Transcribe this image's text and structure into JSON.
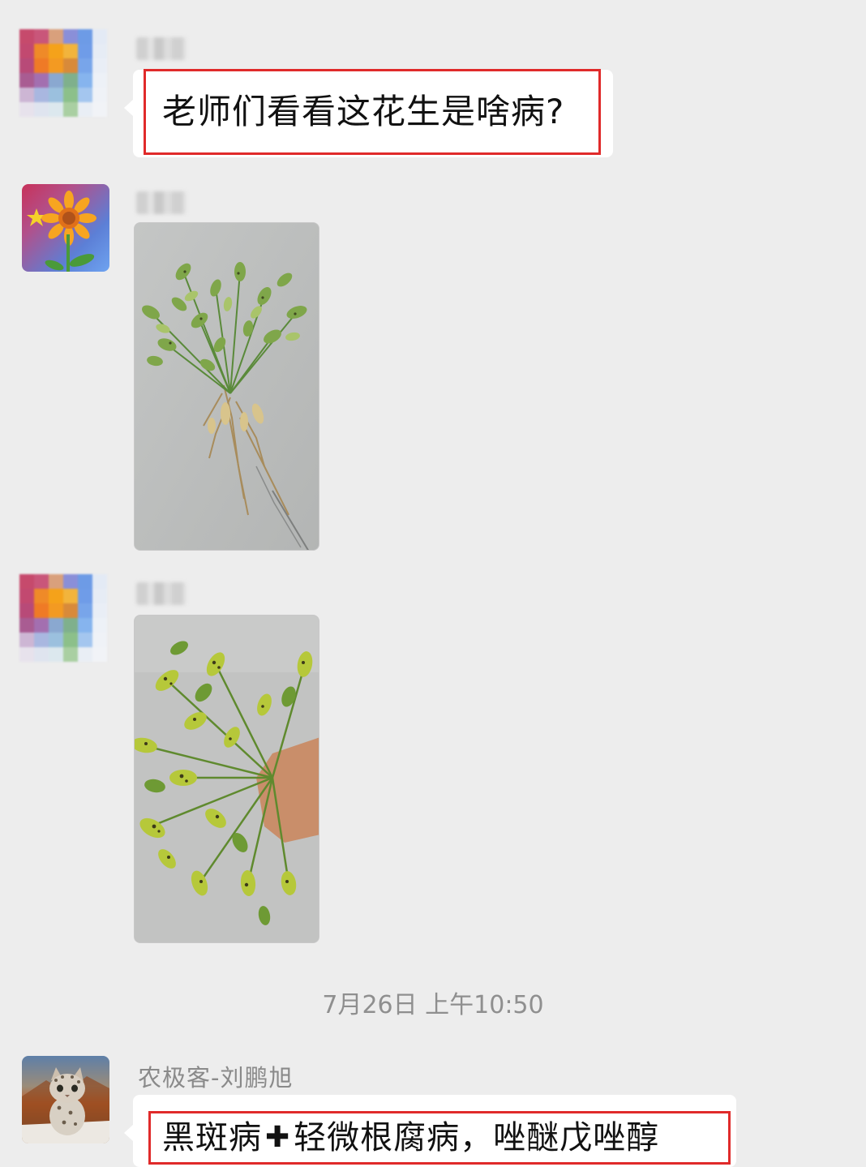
{
  "messages": [
    {
      "sender_name": "",
      "avatar": "pixelated-sunflower-avatar",
      "type": "text",
      "text": "老师们看看这花生是啥病?"
    },
    {
      "sender_name": "",
      "avatar": "sunflower-avatar",
      "type": "image",
      "image": "peanut-plant-with-roots-photo"
    },
    {
      "sender_name": "",
      "avatar": "pixelated-sunflower-avatar",
      "type": "image",
      "image": "peanut-leaves-spotted-photo"
    }
  ],
  "timestamp": "7月26日 上午10:50",
  "reply": {
    "sender_name": "农极客-刘鹏旭",
    "avatar": "cat-avatar",
    "text_part1": "黑斑病",
    "text_plus": "✚",
    "text_part2": "轻微根腐病，唑醚戊唑醇"
  },
  "colors": {
    "background": "#ededed",
    "bubble": "#ffffff",
    "highlight_border": "#e02a2a",
    "meta_text": "#8a8a8a"
  }
}
